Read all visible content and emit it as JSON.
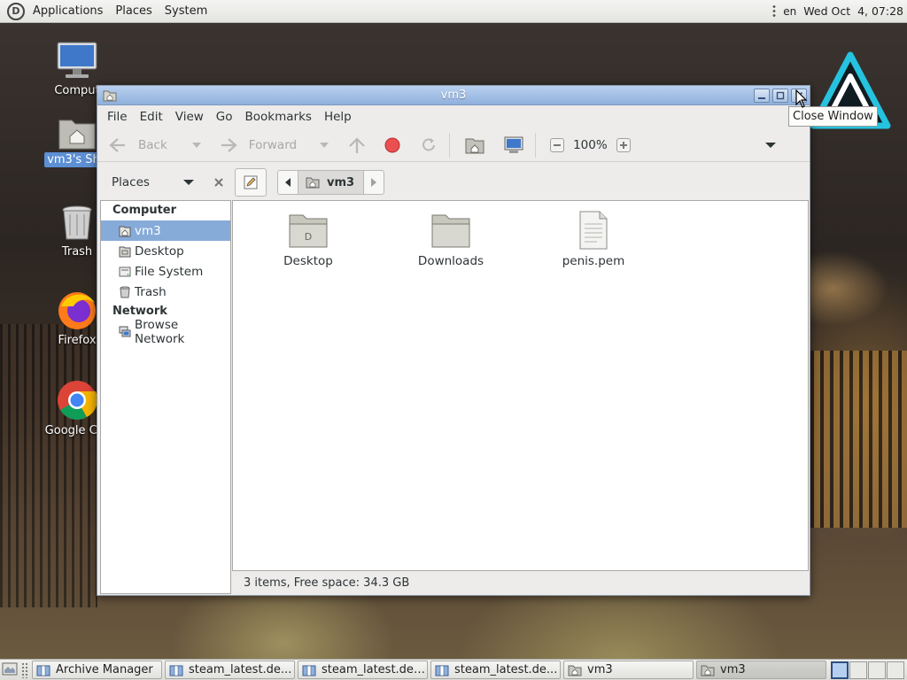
{
  "top_panel": {
    "menus": [
      "Applications",
      "Places",
      "System"
    ],
    "language": "en",
    "clock": "Wed Oct  4, 07:28"
  },
  "desktop_icons": [
    {
      "label": "Comput",
      "icon": "computer-icon"
    },
    {
      "label": "vm3's Sha",
      "icon": "home-folder-icon",
      "selected": true
    },
    {
      "label": "Trash",
      "icon": "trash-icon"
    },
    {
      "label": "Firefox",
      "icon": "firefox-icon"
    },
    {
      "label": "Google Chr",
      "icon": "chrome-icon"
    }
  ],
  "window": {
    "title": "vm3",
    "menubar": [
      "File",
      "Edit",
      "View",
      "Go",
      "Bookmarks",
      "Help"
    ],
    "toolbar": {
      "back_label": "Back",
      "forward_label": "Forward",
      "zoom": "100%"
    },
    "sidepane": {
      "title": "Places",
      "sections": [
        {
          "heading": "Computer",
          "items": [
            {
              "label": "vm3",
              "icon": "home-icon",
              "selected": true
            },
            {
              "label": "Desktop",
              "icon": "desktop-icon"
            },
            {
              "label": "File System",
              "icon": "drive-icon"
            },
            {
              "label": "Trash",
              "icon": "trash-icon"
            }
          ]
        },
        {
          "heading": "Network",
          "items": [
            {
              "label": "Browse Network",
              "icon": "network-icon"
            }
          ]
        }
      ]
    },
    "location": {
      "crumb": "vm3"
    },
    "files": [
      {
        "name": "Desktop",
        "icon": "desktop-folder-icon"
      },
      {
        "name": "Downloads",
        "icon": "folder-icon"
      },
      {
        "name": "penis.pem",
        "icon": "text-file-icon"
      }
    ],
    "status": "3 items, Free space: 34.3 GB"
  },
  "tooltip": "Close Window",
  "taskbar": {
    "tasks": [
      {
        "label": "Archive Manager",
        "icon": "archive-icon"
      },
      {
        "label": "steam_latest.de...",
        "icon": "package-icon"
      },
      {
        "label": "steam_latest.deb...",
        "icon": "package-icon"
      },
      {
        "label": "steam_latest.de...",
        "icon": "package-icon"
      },
      {
        "label": "vm3",
        "icon": "home-folder-icon"
      },
      {
        "label": "vm3",
        "icon": "home-folder-icon",
        "active": true
      }
    ]
  }
}
